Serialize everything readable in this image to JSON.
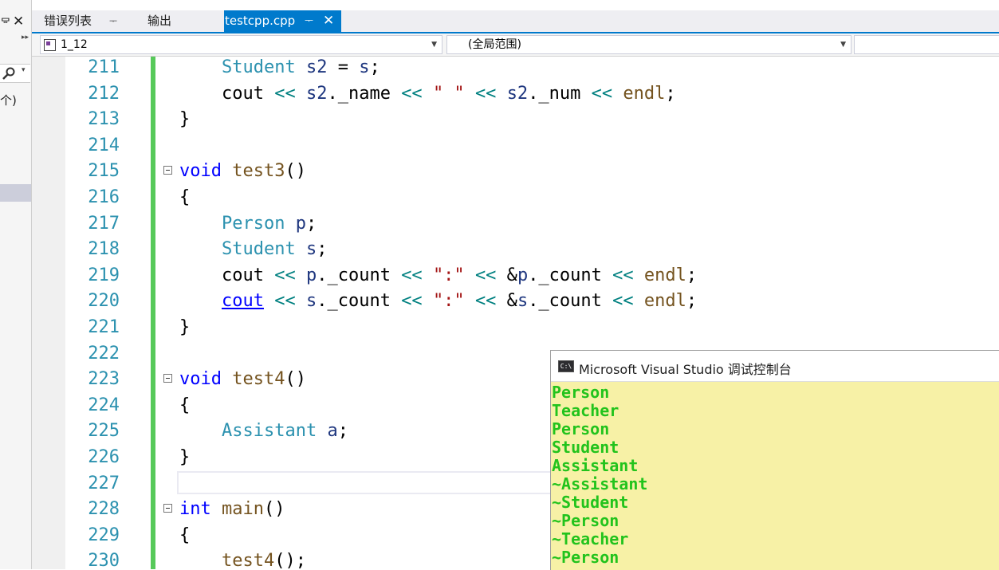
{
  "left_panel": {
    "pin_glyph": "ᄝ",
    "close_glyph": "✕",
    "count_text": "个)"
  },
  "tabs": [
    {
      "label": "错误列表",
      "pin": "ᅮ"
    },
    {
      "label": "输出"
    },
    {
      "label": "testcpp.cpp",
      "pin": "ᅮ",
      "close": "✕",
      "active": true
    }
  ],
  "nav": {
    "project": "1_12",
    "scope": "(全局范围)",
    "third": ""
  },
  "editor": {
    "lines": [
      {
        "n": "211",
        "html": "    <span class='ty'>Student</span> <span class='var'>s2</span> = <span class='var'>s</span>;"
      },
      {
        "n": "212",
        "html": "    cout <span class='op'>&lt;&lt;</span> <span class='var'>s2</span>._name <span class='op'>&lt;&lt;</span> <span class='str'>\" \"</span> <span class='op'>&lt;&lt;</span> <span class='var'>s2</span>._num <span class='op'>&lt;&lt;</span> <span class='fn'>endl</span>;"
      },
      {
        "n": "213",
        "html": "}"
      },
      {
        "n": "214",
        "html": ""
      },
      {
        "n": "215",
        "html": "<span class='kw'>void</span> <span class='fn'>test3</span>()",
        "fold": true
      },
      {
        "n": "216",
        "html": "{"
      },
      {
        "n": "217",
        "html": "    <span class='ty'>Person</span> <span class='var'>p</span>;"
      },
      {
        "n": "218",
        "html": "    <span class='ty'>Student</span> <span class='var'>s</span>;"
      },
      {
        "n": "219",
        "html": "    cout <span class='op'>&lt;&lt;</span> <span class='var'>p</span>._count <span class='op'>&lt;&lt;</span> <span class='str'>\":\"</span> <span class='op'>&lt;&lt;</span> &amp;<span class='var'>p</span>._count <span class='op'>&lt;&lt;</span> <span class='fn'>endl</span>;"
      },
      {
        "n": "220",
        "html": "    <span class='ul'>cout</span> <span class='op'>&lt;&lt;</span> <span class='var'>s</span>._count <span class='op'>&lt;&lt;</span> <span class='str'>\":\"</span> <span class='op'>&lt;&lt;</span> &amp;<span class='var'>s</span>._count <span class='op'>&lt;&lt;</span> <span class='fn'>endl</span>;"
      },
      {
        "n": "221",
        "html": "}"
      },
      {
        "n": "222",
        "html": ""
      },
      {
        "n": "223",
        "html": "<span class='kw'>void</span> <span class='fn'>test4</span>()",
        "fold": true
      },
      {
        "n": "224",
        "html": "{"
      },
      {
        "n": "225",
        "html": "    <span class='ty'>Assistant</span> <span class='var'>a</span>;"
      },
      {
        "n": "226",
        "html": "}"
      },
      {
        "n": "227",
        "html": ""
      },
      {
        "n": "228",
        "html": "<span class='kw'>int</span> <span class='fn'>main</span>()",
        "fold": true
      },
      {
        "n": "229",
        "html": "{"
      },
      {
        "n": "230",
        "html": "    <span class='fn'>test4</span>();"
      }
    ]
  },
  "console": {
    "icon_text": "C:\\",
    "title": "Microsoft Visual Studio 调试控制台",
    "lines": [
      "Person",
      "Teacher",
      "Person",
      "Student",
      "Assistant",
      "~Assistant",
      "~Student",
      "~Person",
      "~Teacher",
      "~Person"
    ]
  }
}
